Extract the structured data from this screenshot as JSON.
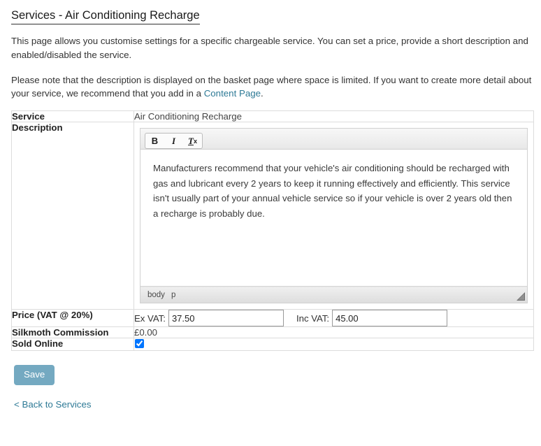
{
  "page": {
    "title": "Services - Air Conditioning Recharge",
    "intro_paragraph_1": "This page allows you customise settings for a specific chargeable service. You can set a price, provide a short description and enabled/disabled the service.",
    "intro_paragraph_2_before_link": "Please note that the description is displayed on the basket page where space is limited. If you want to create more detail about your service, we recommend that you add in a ",
    "intro_link_label": "Content Page",
    "intro_paragraph_2_after_link": "."
  },
  "table": {
    "rows": {
      "service": {
        "label": "Service",
        "value": "Air Conditioning Recharge"
      },
      "description": {
        "label": "Description"
      },
      "price": {
        "label": "Price (VAT @ 20%)"
      },
      "commission": {
        "label": "Silkmoth Commission",
        "value": "£0.00"
      },
      "sold_online": {
        "label": "Sold Online",
        "checked": true
      }
    }
  },
  "editor": {
    "toolbar": {
      "bold_label": "B",
      "italic_label": "I",
      "remove_format_t": "T",
      "remove_format_x": "x"
    },
    "content": "Manufacturers recommend that your vehicle's air conditioning should be recharged with gas and lubricant every 2 years to keep it running effectively and efficiently.  This service isn't usually part of your annual vehicle service so if your vehicle is over 2 years old then a recharge is probably due.",
    "statusbar": {
      "path_body": "body",
      "path_element": "p"
    }
  },
  "price_fields": {
    "ex_vat_label": "Ex VAT:",
    "ex_vat_value": "37.50",
    "inc_vat_label": "Inc VAT:",
    "inc_vat_value": "45.00"
  },
  "actions": {
    "save_label": "Save",
    "back_link_label": "< Back to Services"
  },
  "colors": {
    "accent_button": "#74a9c1",
    "link": "#2e7a96",
    "border": "#dcdcdc",
    "text": "#333333"
  }
}
